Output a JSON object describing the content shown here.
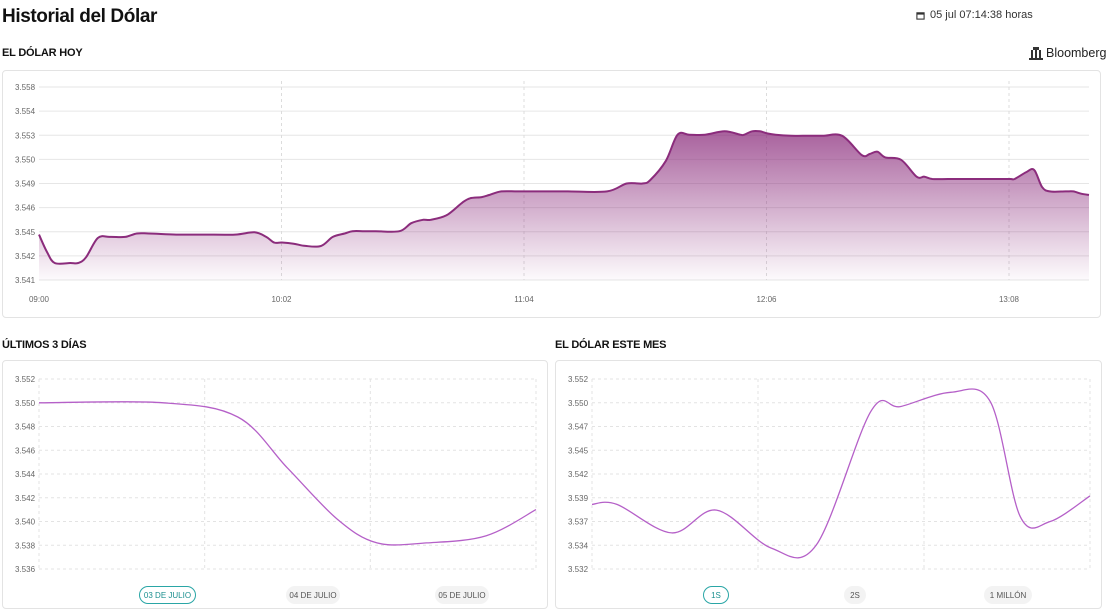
{
  "header": {
    "title": "Historial del Dólar",
    "datetime": "05 jul 07:14:38 horas"
  },
  "source": {
    "label": "Bloomberg",
    "icon": "bank-building-icon"
  },
  "colors": {
    "main_line": "#8b2c7c",
    "main_fill": "#8b2c7c",
    "small_line": "#b560c8",
    "active_pill": "#2aa6a6"
  },
  "sections": {
    "today": "EL DÓLAR HOY",
    "three_days": "ÚLTIMOS 3 DÍAS",
    "month": "EL DÓLAR ESTE MES"
  },
  "chart_data": [
    {
      "id": "today",
      "type": "area",
      "title": "EL DÓLAR HOY",
      "x_tick_labels": [
        "09:00",
        "10:02",
        "11:04",
        "12:06",
        "13:08"
      ],
      "y_tick_labels": [
        "3.558",
        "3.554",
        "3.553",
        "3.550",
        "3.549",
        "3.546",
        "3.545",
        "3.542",
        "3.541"
      ],
      "ylim": [
        3.541,
        3.558
      ],
      "xlim_minutes": [
        0,
        268
      ],
      "grid": true,
      "x_minutes": [
        0,
        2,
        4,
        8,
        10,
        12,
        15,
        18,
        22,
        25,
        28,
        35,
        42,
        50,
        55,
        58,
        60,
        62,
        65,
        68,
        72,
        75,
        78,
        80,
        83,
        86,
        92,
        95,
        98,
        100,
        104,
        108,
        110,
        113,
        115,
        118,
        122,
        126,
        130,
        135,
        145,
        150,
        154,
        156,
        160,
        163,
        166,
        170,
        175,
        179,
        180,
        182,
        184,
        186,
        188,
        192,
        195,
        200,
        205,
        210,
        212,
        214,
        216,
        220,
        224,
        226,
        228,
        232,
        236,
        240,
        244,
        248,
        249,
        252,
        254,
        256,
        258,
        262,
        264,
        266,
        268
      ],
      "y": [
        3.545,
        3.5435,
        3.5425,
        3.5425,
        3.5425,
        3.543,
        3.5447,
        3.5448,
        3.5448,
        3.5451,
        3.5451,
        3.545,
        3.545,
        3.545,
        3.5452,
        3.5448,
        3.5443,
        3.5443,
        3.5442,
        3.544,
        3.544,
        3.5448,
        3.5451,
        3.5453,
        3.5453,
        3.5453,
        3.5453,
        3.546,
        3.5463,
        3.5463,
        3.5467,
        3.5478,
        3.5482,
        3.5483,
        3.5485,
        3.5488,
        3.5488,
        3.5488,
        3.5488,
        3.5488,
        3.5488,
        3.5495,
        3.5495,
        3.5498,
        3.5515,
        3.5538,
        3.5538,
        3.5538,
        3.5541,
        3.5538,
        3.5538,
        3.5541,
        3.5541,
        3.5539,
        3.5538,
        3.5537,
        3.5537,
        3.5537,
        3.5537,
        3.552,
        3.5521,
        3.5523,
        3.5518,
        3.5516,
        3.5501,
        3.5501,
        3.5499,
        3.5499,
        3.5499,
        3.5499,
        3.5499,
        3.5499,
        3.5499,
        3.5505,
        3.5507,
        3.5492,
        3.5488,
        3.5488,
        3.5488,
        3.5486,
        3.5485
      ]
    },
    {
      "id": "three_days",
      "type": "line",
      "title": "ÚLTIMOS 3 DÍAS",
      "categories": [
        "03 DE JULIO",
        "04 DE JULIO",
        "05 DE JULIO"
      ],
      "y_tick_labels": [
        "3.552",
        "3.550",
        "3.548",
        "3.546",
        "3.544",
        "3.542",
        "3.540",
        "3.538",
        "3.536"
      ],
      "ylim": [
        3.536,
        3.552
      ],
      "grid": true,
      "x": [
        0,
        0.25,
        0.45,
        0.6,
        0.75,
        1.0
      ],
      "y": [
        3.55,
        3.55,
        3.5485,
        3.541,
        3.5382,
        3.5378
      ]
    },
    {
      "id": "month",
      "type": "line",
      "title": "EL DÓLAR ESTE MES",
      "categories": [
        "1S",
        "2S",
        "1 MILLÓN"
      ],
      "y_tick_labels": [
        "3.552",
        "3.550",
        "3.547",
        "3.545",
        "3.542",
        "3.539",
        "3.537",
        "3.534",
        "3.532"
      ],
      "ylim": [
        3.532,
        3.552
      ],
      "grid": true,
      "x": [
        0,
        0.05,
        0.16,
        0.25,
        0.36,
        0.45,
        0.56,
        0.62,
        0.72,
        0.8,
        0.86,
        0.92,
        1.0
      ],
      "y": [
        3.5388,
        3.5388,
        3.5358,
        3.5382,
        3.5342,
        3.5345,
        3.5486,
        3.5491,
        3.5506,
        3.5496,
        3.5375,
        3.537,
        3.5397
      ]
    }
  ],
  "three_days_tail": {
    "x": 1.0,
    "y": 3.541
  },
  "pills": {
    "three_days": [
      {
        "label": "03 DE JULIO",
        "active": true
      },
      {
        "label": "04 DE JULIO",
        "active": false
      },
      {
        "label": "05 DE JULIO",
        "active": false
      }
    ],
    "month": [
      {
        "label": "1S",
        "active": true
      },
      {
        "label": "2S",
        "active": false
      },
      {
        "label": "1 MILLÓN",
        "active": false
      }
    ]
  }
}
